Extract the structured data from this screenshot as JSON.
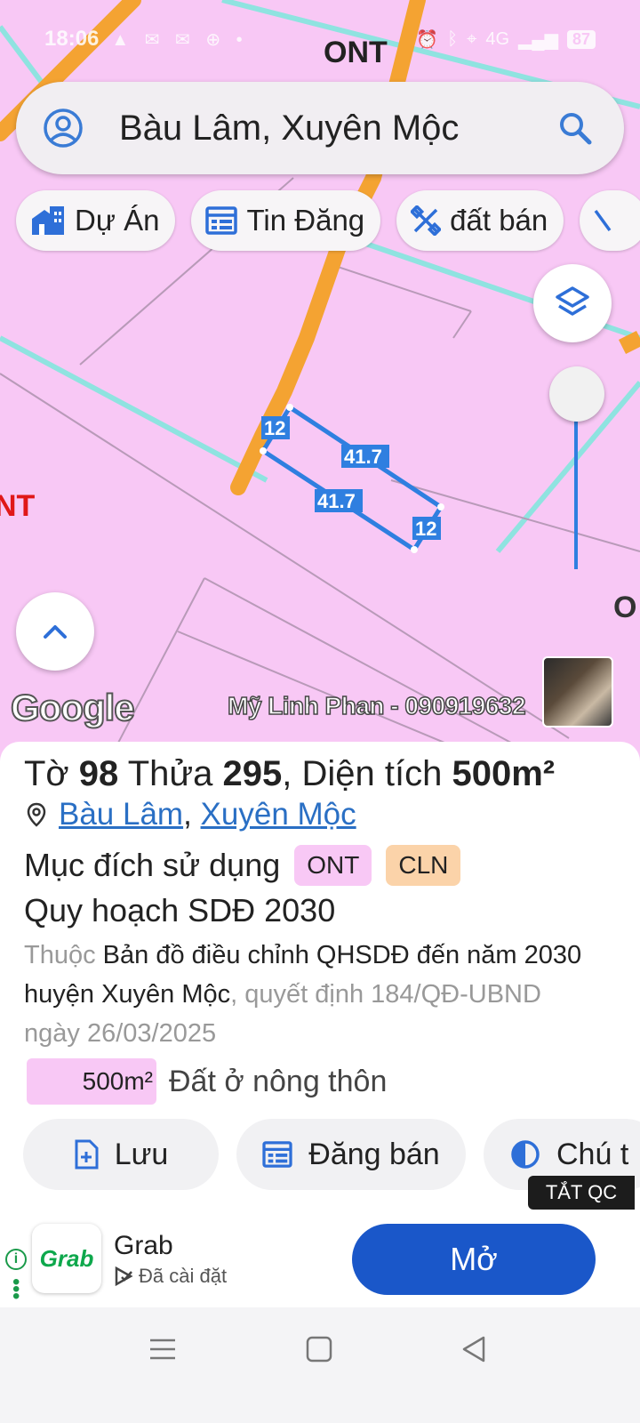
{
  "status_bar": {
    "time": "18:06",
    "battery": "87",
    "network": "4G"
  },
  "map": {
    "zone_labels": [
      "ONT",
      "NT",
      "O"
    ],
    "dimensions": [
      "12",
      "41.7",
      "41.7",
      "12"
    ],
    "attribution": "Google",
    "watermark": "Mỹ Linh Phan - 090919632"
  },
  "search": {
    "query": "Bàu Lâm, Xuyên Mộc"
  },
  "chips": [
    {
      "label": "Dự Án",
      "icon": "building-icon"
    },
    {
      "label": "Tin Đăng",
      "icon": "listing-icon"
    },
    {
      "label": "đất bán",
      "icon": "ruler-icon"
    }
  ],
  "parcel": {
    "sheet_label": "Tờ",
    "sheet_no": "98",
    "lot_label": "Thửa",
    "lot_no": "295",
    "area_label": "Diện tích",
    "area_value": "500m²",
    "location_commune": "Bàu Lâm",
    "location_district": "Xuyên Mộc",
    "purpose_label": "Mục đích sử dụng",
    "purpose_tags": [
      {
        "code": "ONT",
        "color": "#f8c8f5"
      },
      {
        "code": "CLN",
        "color": "#fbd3a9"
      }
    ],
    "plan_title": "Quy hoạch SDĐ 2030",
    "desc_prefix": "Thuộc",
    "desc_doc": "Bản đồ điều chỉnh QHSDĐ đến năm 2030 huyện Xuyên Mộc",
    "desc_suffix": ", quyết định 184/QĐ-UBND ngày 26/03/2025",
    "zone_area": "500m²",
    "zone_name": "Đất ở nông thôn"
  },
  "actions": [
    {
      "label": "Lưu",
      "icon": "save-icon"
    },
    {
      "label": "Đăng bán",
      "icon": "listing-icon"
    },
    {
      "label": "Chú t",
      "icon": "contrast-icon"
    }
  ],
  "ad": {
    "close_label": "TẮT QC",
    "logo_text": "Grab",
    "app_name": "Grab",
    "status": "Đã cài đặt",
    "cta": "Mở"
  },
  "colors": {
    "map_bg": "#f8c8f5",
    "road": "#f4a332",
    "parcel": "#2f7fe0",
    "primary": "#1a57c9"
  }
}
